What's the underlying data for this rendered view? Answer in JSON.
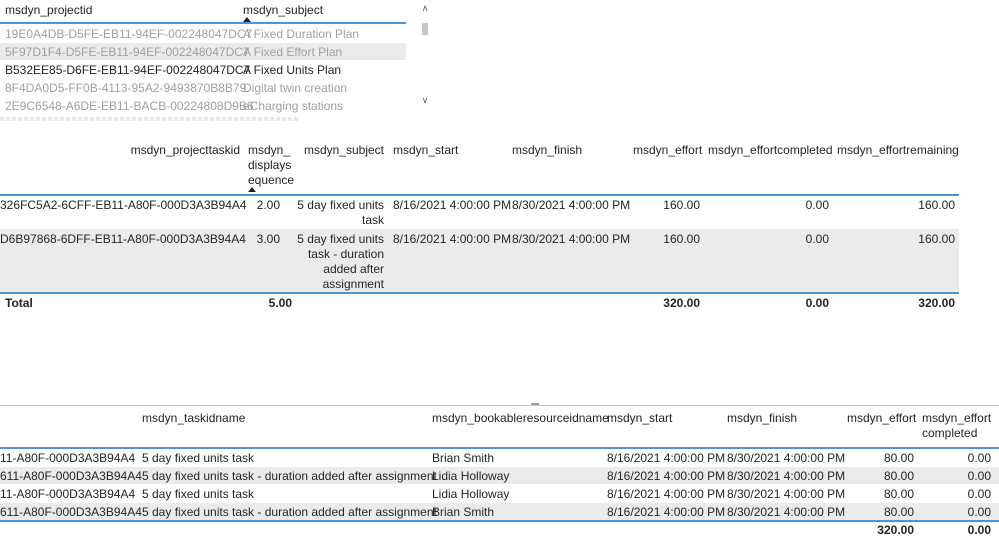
{
  "table1": {
    "headers": [
      "msdyn_projectid",
      "msdyn_subject"
    ],
    "rows": [
      {
        "id": "19E0A4DB-D5FE-EB11-94EF-002248047DC7",
        "subject": "A Fixed Duration Plan",
        "dim": true
      },
      {
        "id": "5F97D1F4-D5FE-EB11-94EF-002248047DC7",
        "subject": "A Fixed Effort Plan",
        "dim": true
      },
      {
        "id": "B532EE85-D6FE-EB11-94EF-002248047DC7",
        "subject": "A Fixed Units Plan",
        "dim": false
      },
      {
        "id": "8F4DA0D5-FF0B-4113-95A2-9493870B8B79",
        "subject": "Digital twin creation",
        "dim": true
      },
      {
        "id": "2E9C6548-A6DE-EB11-BACB-00224808D9B6",
        "subject": "eCharging stations",
        "dim": true
      }
    ]
  },
  "table2": {
    "headers": {
      "taskid": "msdyn_projecttaskid",
      "seq": [
        "msdyn_",
        "displays",
        "equence"
      ],
      "subject": "msdyn_subject",
      "start": "msdyn_start",
      "finish": "msdyn_finish",
      "effort": "msdyn_effort",
      "completed": "msdyn_effortcompleted",
      "remaining": "msdyn_effortremaining"
    },
    "rows": [
      {
        "taskid": "326FC5A2-6CFF-EB11-A80F-000D3A3B94A4",
        "seq": "2.00",
        "subject": [
          "5 day fixed units",
          "task"
        ],
        "start": "8/16/2021 4:00:00 PM",
        "finish": "8/30/2021 4:00:00 PM",
        "effort": "160.00",
        "completed": "0.00",
        "remaining": "160.00"
      },
      {
        "taskid": "D6B97868-6DFF-EB11-A80F-000D3A3B94A4",
        "seq": "3.00",
        "subject": [
          "5 day fixed units",
          "task - duration",
          "added after",
          "assignment"
        ],
        "start": "8/16/2021 4:00:00 PM",
        "finish": "8/30/2021 4:00:00 PM",
        "effort": "160.00",
        "completed": "0.00",
        "remaining": "160.00"
      }
    ],
    "total": {
      "label": "Total",
      "seq": "5.00",
      "effort": "320.00",
      "completed": "0.00",
      "remaining": "320.00"
    }
  },
  "table3": {
    "headers": {
      "taskidname": "msdyn_taskidname",
      "resource": "msdyn_bookableresourceidname",
      "start": "msdyn_start",
      "finish": "msdyn_finish",
      "effort": "msdyn_effort",
      "completed": [
        "msdyn_effort",
        "completed"
      ]
    },
    "rows": [
      {
        "taskid": "11-A80F-000D3A3B94A4",
        "taskidname": "5 day fixed units task",
        "resource": "Brian Smith",
        "start": "8/16/2021 4:00:00 PM",
        "finish": "8/30/2021 4:00:00 PM",
        "effort": "80.00",
        "completed": "0.00"
      },
      {
        "taskid": "611-A80F-000D3A3B94A4",
        "taskidname": "5 day fixed units task - duration added after assignment",
        "resource": "Lidia Holloway",
        "start": "8/16/2021 4:00:00 PM",
        "finish": "8/30/2021 4:00:00 PM",
        "effort": "80.00",
        "completed": "0.00"
      },
      {
        "taskid": "11-A80F-000D3A3B94A4",
        "taskidname": "5 day fixed units task",
        "resource": "Lidia Holloway",
        "start": "8/16/2021 4:00:00 PM",
        "finish": "8/30/2021 4:00:00 PM",
        "effort": "80.00",
        "completed": "0.00"
      },
      {
        "taskid": "611-A80F-000D3A3B94A4",
        "taskidname": "5 day fixed units task - duration added after assignment",
        "resource": "Brian Smith",
        "start": "8/16/2021 4:00:00 PM",
        "finish": "8/30/2021 4:00:00 PM",
        "effort": "80.00",
        "completed": "0.00"
      }
    ],
    "total": {
      "effort": "320.00",
      "completed": "0.00"
    }
  },
  "colors": {
    "accent_line": "#4d94d6",
    "row_alt": "#ebebeb",
    "dim_text": "#a19f9d"
  },
  "icons": {
    "sort": "sort-ascending-icon",
    "scroll_up": "chevron-up-icon",
    "scroll_down": "chevron-down-icon"
  }
}
